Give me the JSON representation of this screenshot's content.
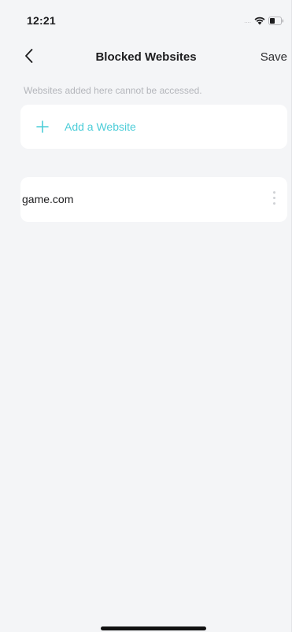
{
  "status_bar": {
    "time": "12:21",
    "signal_indicator": "....",
    "icons": [
      "wifi-icon",
      "battery-icon"
    ]
  },
  "nav": {
    "back_icon": "chevron-left-icon",
    "title": "Blocked Websites",
    "save_label": "Save"
  },
  "hint": "Websites added here cannot be accessed.",
  "add_website": {
    "icon": "plus-icon",
    "label": "Add a Website"
  },
  "websites": [
    {
      "name": "game.com",
      "menu_icon": "more-vertical-icon"
    }
  ],
  "colors": {
    "background": "#f4f5f7",
    "card": "#ffffff",
    "accent": "#4ccdd8",
    "hint": "#b4b6bb",
    "text": "#1c1c1e"
  }
}
